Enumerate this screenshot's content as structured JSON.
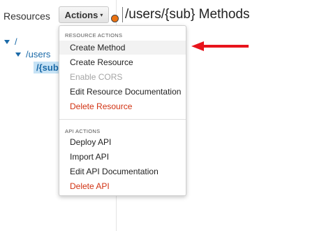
{
  "left_panel": {
    "heading": "Resources",
    "tree": [
      {
        "label": "/"
      },
      {
        "label": "/users"
      },
      {
        "label": "/{sub}"
      }
    ]
  },
  "header": {
    "actions_label": "Actions",
    "caret_icon": "caret-down-icon",
    "title": "/users/{sub} Methods"
  },
  "menu": {
    "resource_section_label": "RESOURCE ACTIONS",
    "resource_items": [
      {
        "label": "Create Method"
      },
      {
        "label": "Create Resource"
      },
      {
        "label": "Enable CORS"
      },
      {
        "label": "Edit Resource Documentation"
      },
      {
        "label": "Delete Resource"
      }
    ],
    "api_section_label": "API ACTIONS",
    "api_items": [
      {
        "label": "Deploy API"
      },
      {
        "label": "Import API"
      },
      {
        "label": "Edit API Documentation"
      },
      {
        "label": "Delete API"
      }
    ]
  },
  "colors": {
    "link": "#1a6aa8",
    "danger": "#d13212",
    "disabled": "#a5a5a5",
    "selected_bg": "#c6e2f5",
    "orange": "#ec7211",
    "arrow": "#e8141c"
  }
}
